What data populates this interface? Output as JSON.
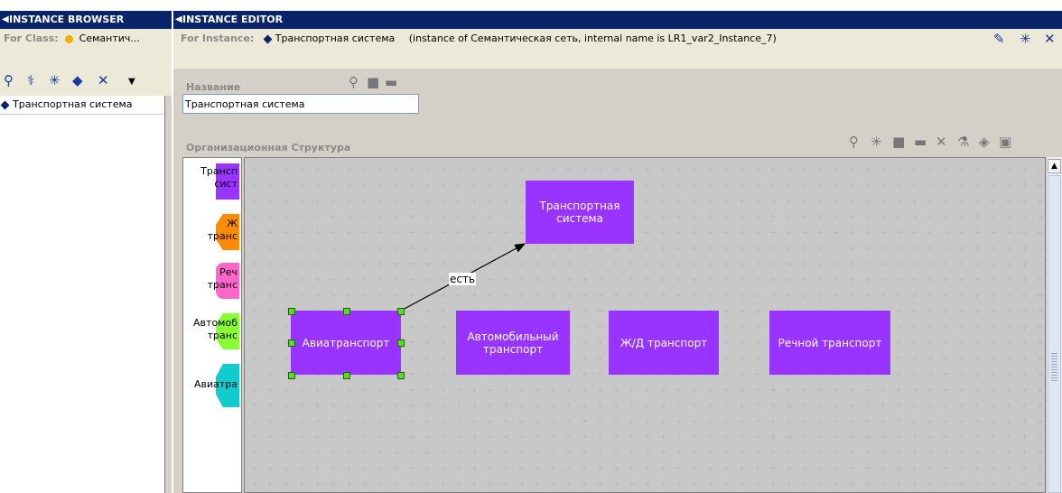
{
  "browser": {
    "title": "INSTANCE BROWSER",
    "for_class_label": "For Class:",
    "class_name": "Семантич...",
    "instances": [
      "Транспортная система"
    ]
  },
  "editor": {
    "title": "INSTANCE EDITOR",
    "for_instance_label": "For Instance:",
    "instance_name": "Транспортная система",
    "instance_info": "(instance of Семантическая сеть, internal name is LR1_var2_Instance_7)",
    "name_label": "Название",
    "name_value": "Транспортная система",
    "structure_label": "Организационная Структура"
  },
  "palette": [
    {
      "text": "Трансп\nсист",
      "color": "#9933ff"
    },
    {
      "text": "Ж\nтранс",
      "color": "#ff8c00"
    },
    {
      "text": "Реч\nтранс",
      "color": "#ff66cc"
    },
    {
      "text": "Автомоб\nтранс",
      "color": "#88ff33"
    },
    {
      "text": "Авиатра",
      "color": "#11cccc"
    }
  ],
  "diagram": {
    "nodes": [
      "Транспортная система",
      "Авиатранспорт",
      "Автомобильный транспорт",
      "Ж/Д транспорт",
      "Речной транспорт"
    ],
    "edge_label": "есть"
  }
}
